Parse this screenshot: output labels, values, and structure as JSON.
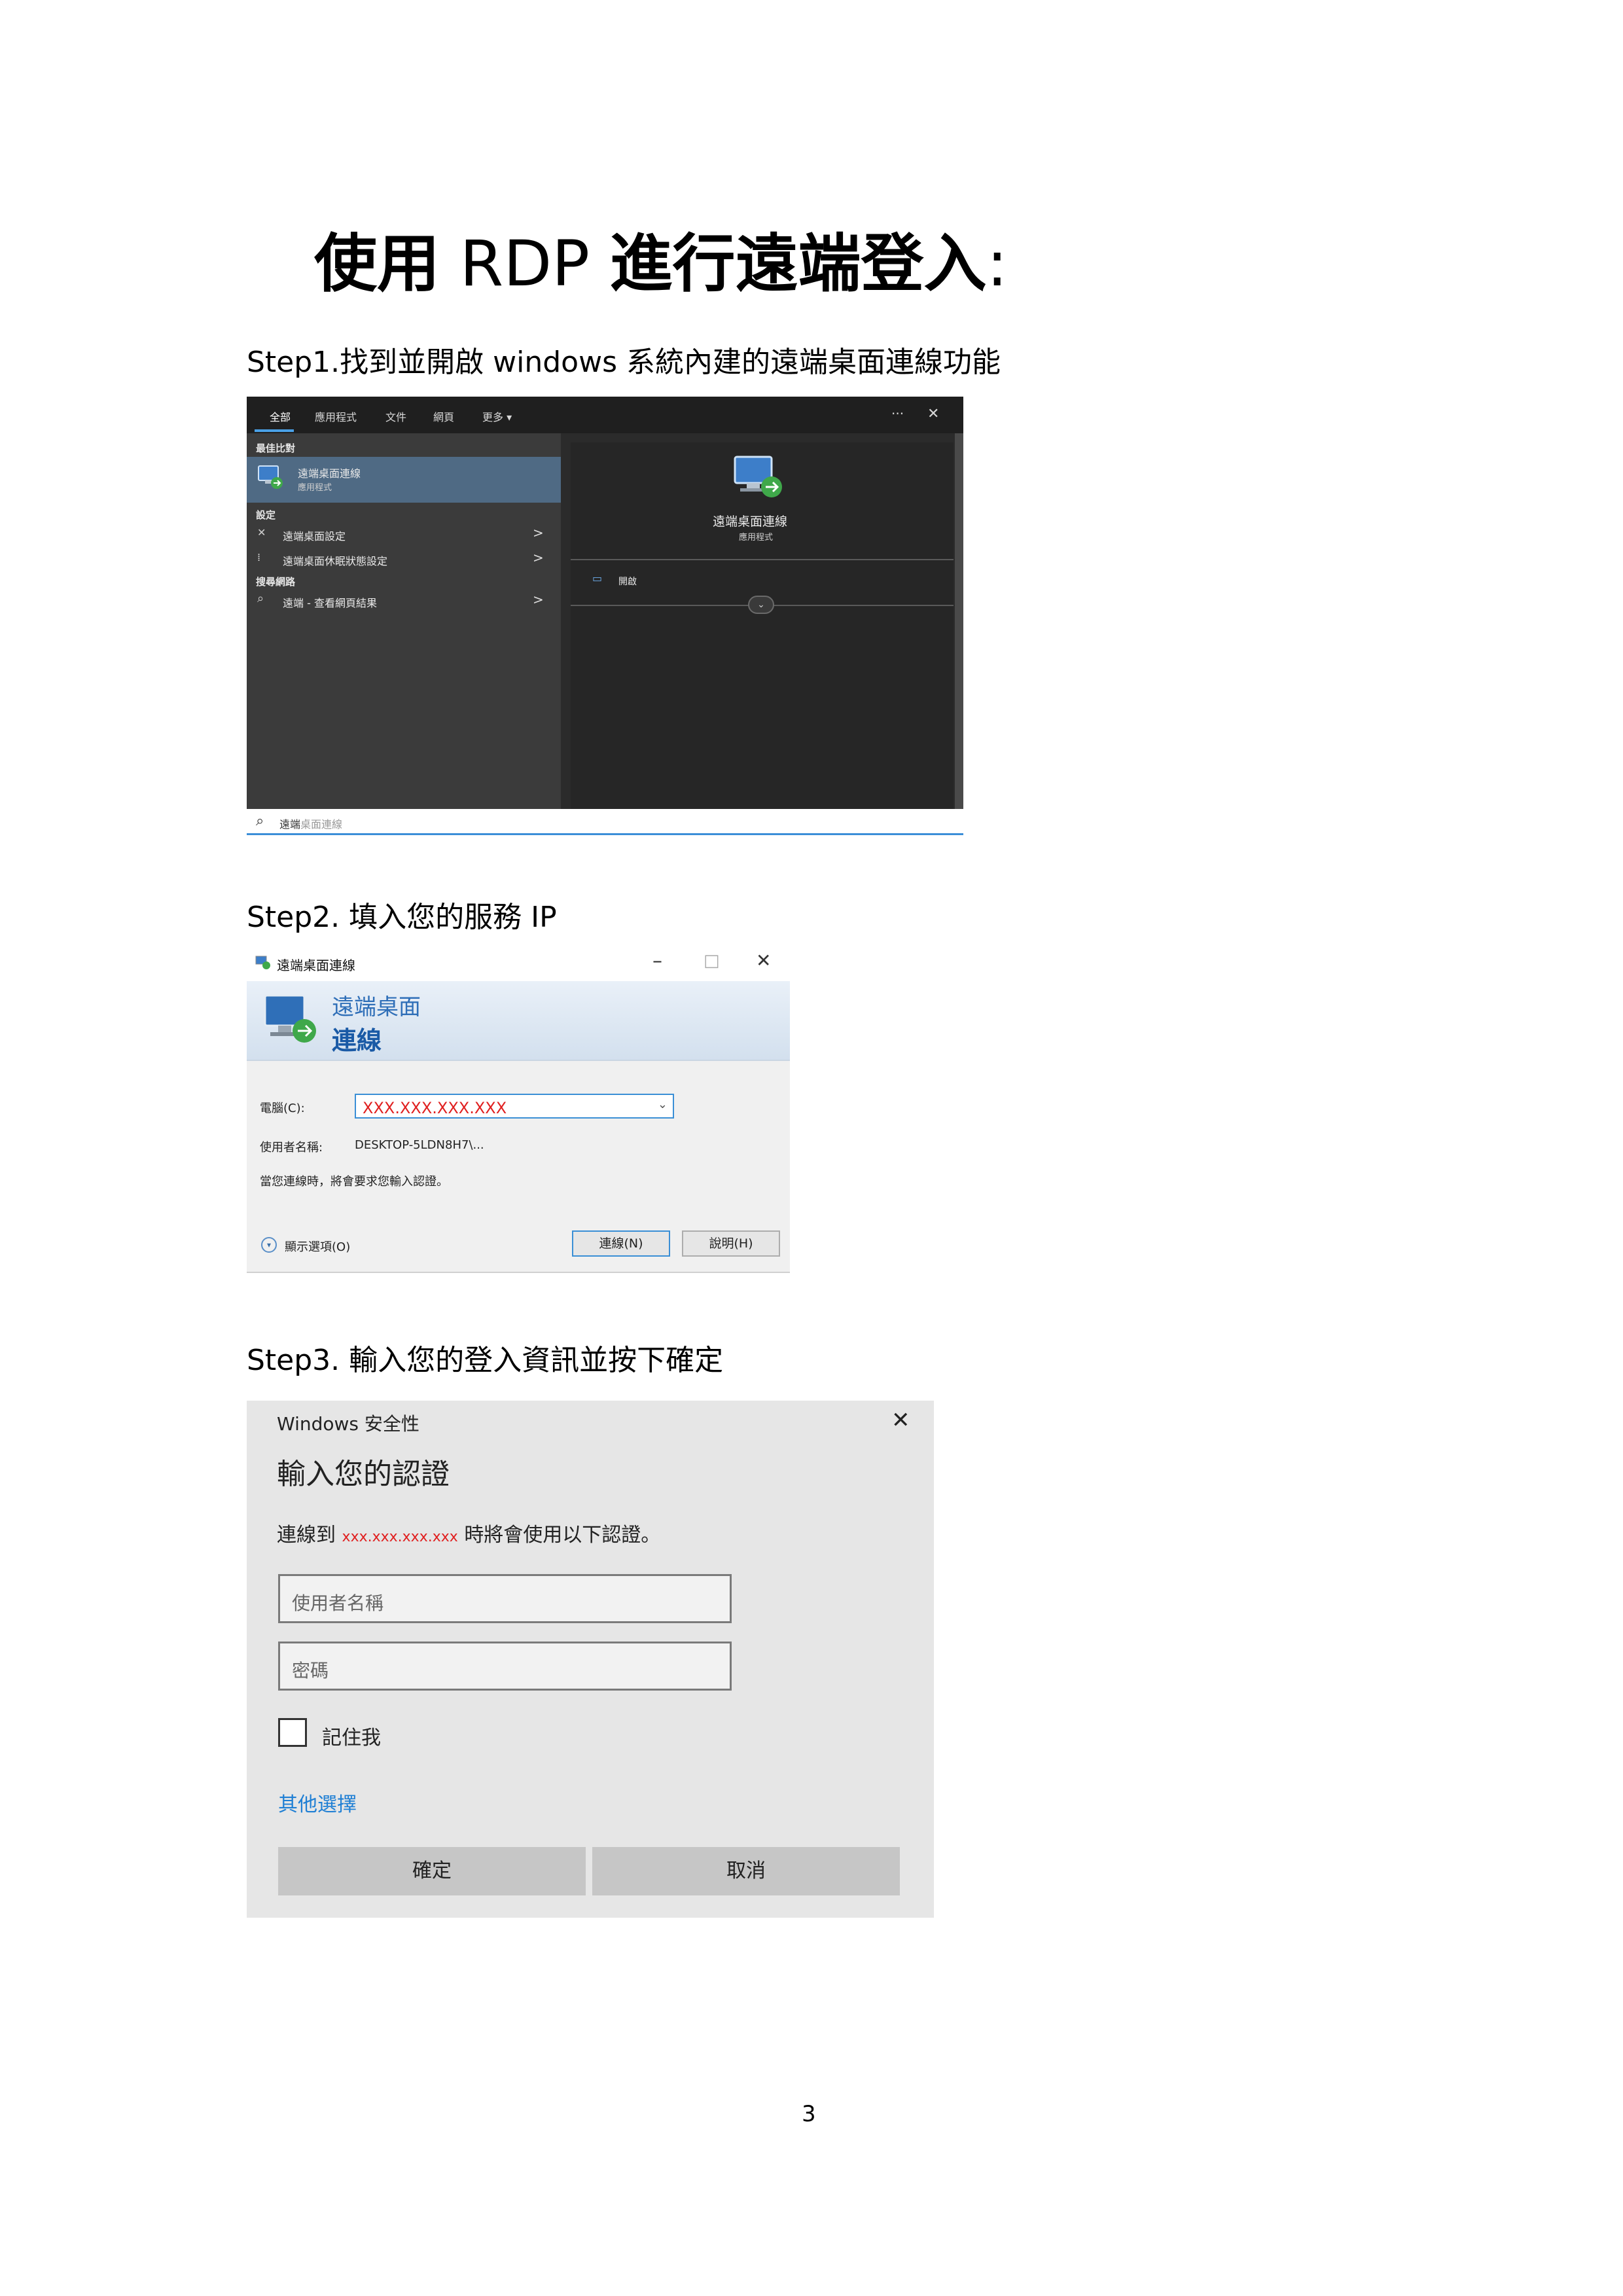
{
  "title": {
    "part1": "使用",
    "part2": " RDP ",
    "part3": "進行遠端登入",
    "part4": ":"
  },
  "steps": {
    "step1": "Step1.找到並開啟 windows 系統內建的遠端桌面連線功能",
    "step2": "Step2.  填入您的服務 IP",
    "step3": "Step3.  輸入您的登入資訊並按下確定"
  },
  "page_number": "3",
  "search_panel": {
    "tabs": [
      "全部",
      "應用程式",
      "文件",
      "網頁",
      "更多 ▾"
    ],
    "more_dots": "···",
    "close": "✕",
    "best_match_header": "最佳比對",
    "best_match_title": "遠端桌面連線",
    "best_match_sub": "應用程式",
    "settings_header": "設定",
    "settings_items": [
      "遠端桌面設定",
      "遠端桌面休眠狀態設定"
    ],
    "web_header": "搜尋網路",
    "web_item": "遠端 - 查看網頁結果",
    "chevron": ">",
    "right_title": "遠端桌面連線",
    "right_sub": "應用程式",
    "right_action": "開啟",
    "search_typed": "遠端",
    "search_ghost": "桌面連線"
  },
  "rdp_dialog": {
    "window_title": "遠端桌面連線",
    "min": "–",
    "max": "□",
    "close": "✕",
    "banner_line1": "遠端桌面",
    "banner_line2": "連線",
    "computer_label": "電腦(C):",
    "computer_value": "XXX.XXX.XXX.XXX",
    "username_label": "使用者名稱:",
    "username_value": "DESKTOP-5LDN8H7\\...",
    "note": "當您連線時，將會要求您輸入認證。",
    "show_options": "顯示選項(O)",
    "connect_button": "連線(N)",
    "help_button": "說明(H)"
  },
  "security_dialog": {
    "window_title": "Windows 安全性",
    "close": "✕",
    "heading": "輸入您的認證",
    "connect_prefix": "連線到",
    "connect_host": "xxx.xxx.xxx.xxx",
    "connect_suffix": "時將會使用以下認證。",
    "username_placeholder": "使用者名稱",
    "password_placeholder": "密碼",
    "remember_me": "記住我",
    "more_choices": "其他選擇",
    "ok_button": "確定",
    "cancel_button": "取消"
  },
  "colors": {
    "accent_blue": "#3a8fd6",
    "ip_red": "#e02020",
    "link_blue": "#1f7fd4"
  }
}
